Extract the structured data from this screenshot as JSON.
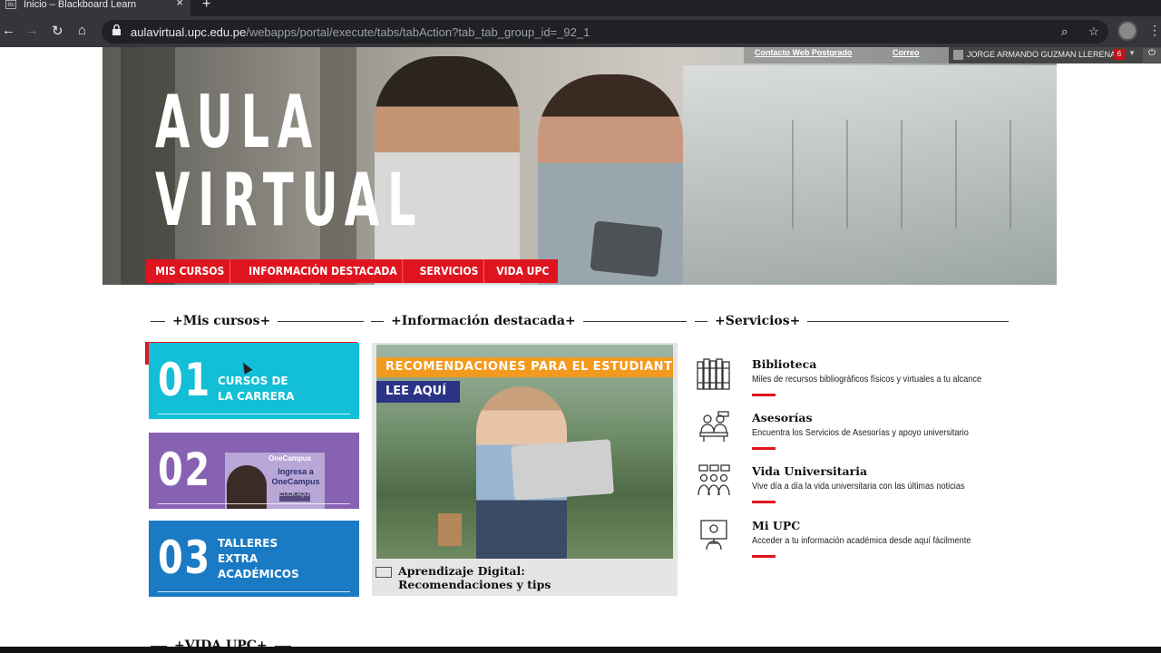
{
  "browser": {
    "tab_title": "Inicio – Blackboard Learn",
    "favicon_text": "Bb",
    "url_host": "aulavirtual.upc.edu.pe",
    "url_path": "/webapps/portal/execute/tabs/tabAction?tab_tab_group_id=_92_1"
  },
  "topbar": {
    "link1": "Contacto Web Postgrado",
    "link2": "Correo",
    "user_name": "JORGE ARMANDO GUZMAN LLERENA",
    "notif_count": "6"
  },
  "hero": {
    "title_line1": "AULA",
    "title_line2": "VIRTUAL",
    "nav": [
      "MIS CURSOS",
      "INFORMACIÓN DESTACADA",
      "SERVICIOS",
      "VIDA UPC"
    ]
  },
  "sections": {
    "mis_cursos": "+Mis cursos+",
    "informacion": "+Información destacada+",
    "servicios": "+Servicios+",
    "vida": "+VIDA UPC+"
  },
  "tiles": [
    {
      "num": "01",
      "line1": "CURSOS DE",
      "line2": "LA CARRERA",
      "color": "#12bfd6"
    },
    {
      "num": "02",
      "promo_brand": "OneCampus",
      "promo_text": "Ingresa a OneCampus",
      "promo_btn": "CLICK AQUÍ",
      "color": "#8762b3"
    },
    {
      "num": "03",
      "line1": "TALLERES",
      "line2": "EXTRA",
      "line3": "ACADÉMICOS",
      "color": "#1a7bc4"
    }
  ],
  "info": {
    "banner": "RECOMENDACIONES PARA EL ESTUDIANTE ONLINE",
    "lee": "LEE AQUÍ",
    "caption_line1": "Aprendizaje Digital:",
    "caption_line2": "Recomendaciones y tips"
  },
  "services": [
    {
      "icon": "books-icon",
      "title": "Biblioteca",
      "desc": "Miles de recursos bibliográficos físicos y virtuales a tu alcance"
    },
    {
      "icon": "advisory-icon",
      "title": "Asesorías",
      "desc": "Encuentra los Servicios de Asesorías y apoyo universitario"
    },
    {
      "icon": "people-icon",
      "title": "Vida Universitaria",
      "desc": "Vive día a día la vida universitaria con las últimas noticias"
    },
    {
      "icon": "computer-user-icon",
      "title": "Mi UPC",
      "desc": "Acceder a tu información académica desde aquí fácilmente"
    }
  ],
  "colors": {
    "accent_red": "#e0141e",
    "banner_orange": "#f39a1e",
    "navy": "#2b3386"
  }
}
